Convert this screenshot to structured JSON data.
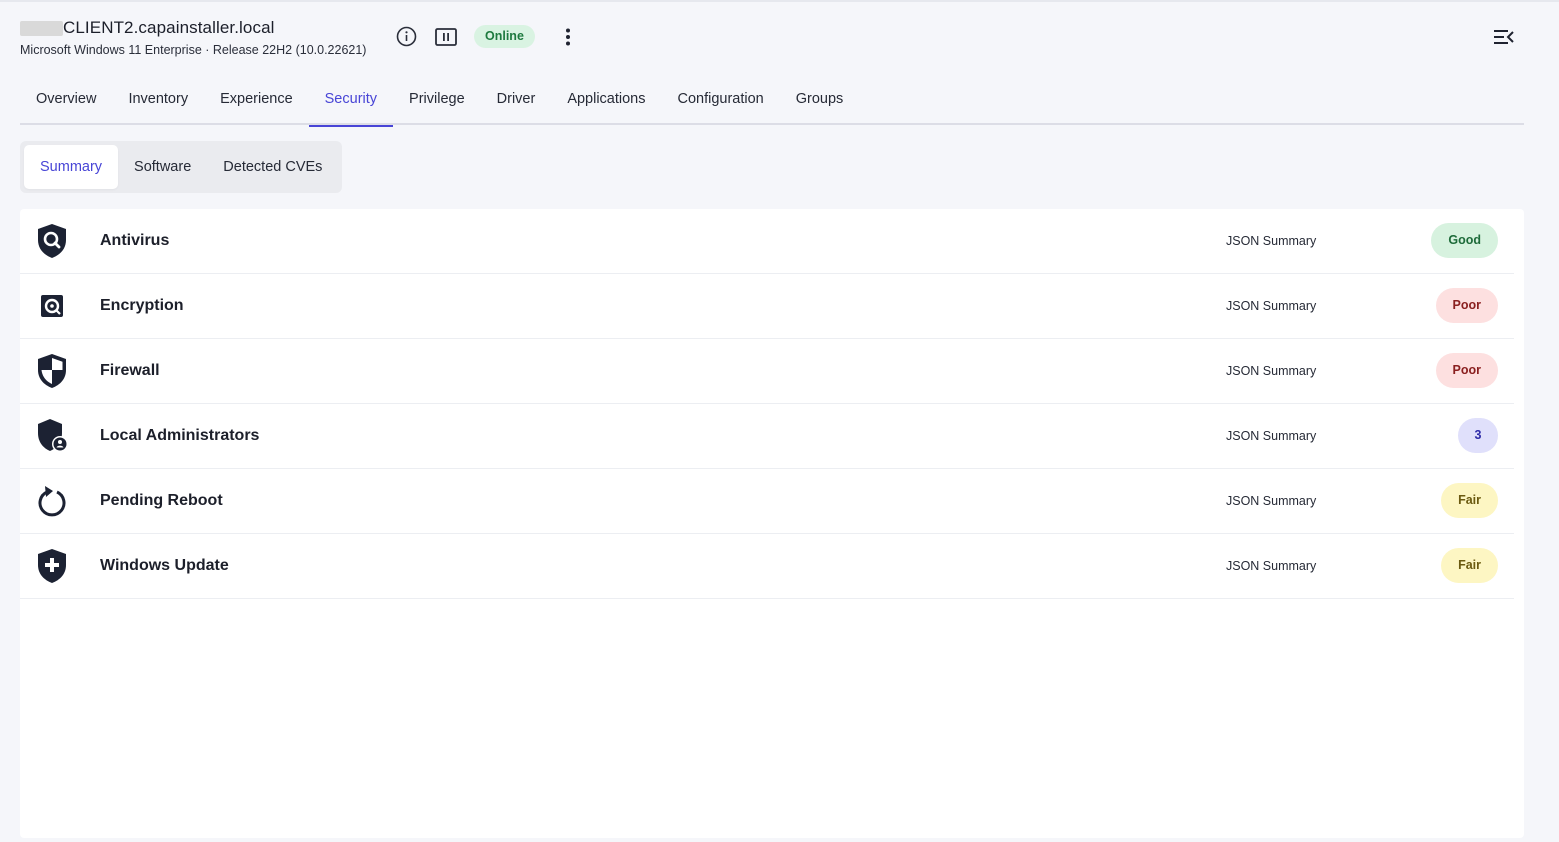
{
  "header": {
    "device_name": "CLIENT2.capainstaller.local",
    "os_info": "Microsoft Windows 11 Enterprise · Release 22H2 (10.0.22621)",
    "status": "Online",
    "status_color": "#1e7a3f"
  },
  "main_tabs": [
    {
      "label": "Overview"
    },
    {
      "label": "Inventory"
    },
    {
      "label": "Experience"
    },
    {
      "label": "Security"
    },
    {
      "label": "Privilege"
    },
    {
      "label": "Driver"
    },
    {
      "label": "Applications"
    },
    {
      "label": "Configuration"
    },
    {
      "label": "Groups"
    }
  ],
  "active_main_tab": "Security",
  "sub_tabs": [
    {
      "label": "Summary"
    },
    {
      "label": "Software"
    },
    {
      "label": "Detected CVEs"
    }
  ],
  "active_sub_tab": "Summary",
  "accent_color": "#4845d6",
  "security_items": [
    {
      "icon": "antivirus-shield-search-icon",
      "label": "Antivirus",
      "json_link": "JSON Summary",
      "status": "Good"
    },
    {
      "icon": "disk-encryption-icon",
      "label": "Encryption",
      "json_link": "JSON Summary",
      "status": "Poor"
    },
    {
      "icon": "firewall-shield-icon",
      "label": "Firewall",
      "json_link": "JSON Summary",
      "status": "Poor"
    },
    {
      "icon": "admin-shield-user-icon",
      "label": "Local Administrators",
      "json_link": "JSON Summary",
      "status": "3"
    },
    {
      "icon": "reboot-arrow-icon",
      "label": "Pending Reboot",
      "json_link": "JSON Summary",
      "status": "Fair"
    },
    {
      "icon": "windows-update-shield-plus-icon",
      "label": "Windows Update",
      "json_link": "JSON Summary",
      "status": "Fair"
    }
  ]
}
